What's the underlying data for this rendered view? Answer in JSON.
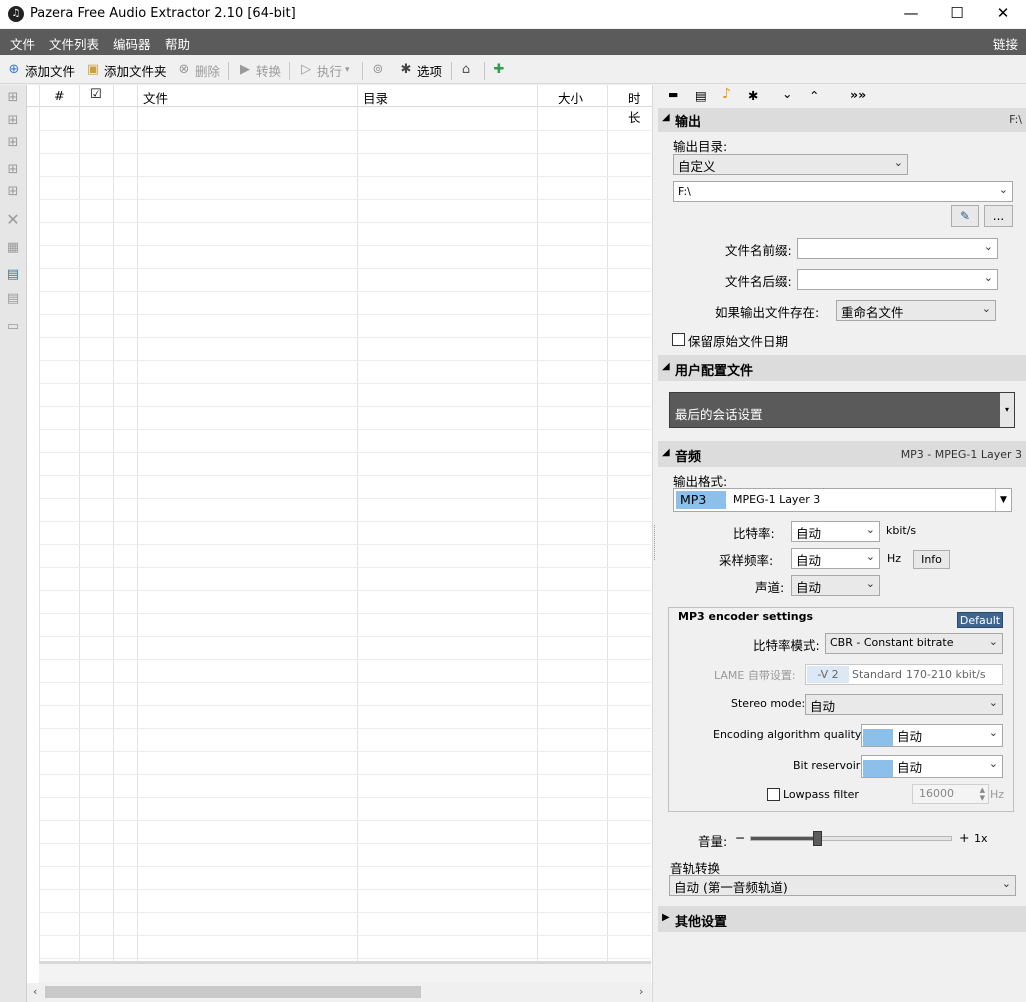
{
  "window": {
    "title": "Pazera Free Audio Extractor 2.10  [64-bit]",
    "app_icon": "♫",
    "minimize": "—",
    "maximize": "☐",
    "close": "✕"
  },
  "menu": {
    "file": "文件",
    "filelist": "文件列表",
    "codec": "编码器",
    "help": "帮助",
    "links": "链接"
  },
  "toolbar": {
    "add_files": "添加文件",
    "add_folder": "添加文件夹",
    "delete": "删除",
    "convert": "转换",
    "execute": "执行",
    "options": "选项"
  },
  "grid": {
    "columns": {
      "num": "#",
      "check": "☑",
      "file": "文件",
      "dir": "目录",
      "size": "大小",
      "duration": "时长"
    }
  },
  "panel_tabs": {
    "folder": "▬",
    "doc": "▤",
    "music": "♪",
    "gear": "✱",
    "down": "⌄",
    "up": "⌃",
    "more": "»»"
  },
  "output": {
    "header": "输出",
    "drive": "F:\\",
    "dir_label": "输出目录:",
    "dir_mode": "自定义",
    "dir_path": "F:\\",
    "browse": "...",
    "prefix_label": "文件名前缀:",
    "prefix_value": "",
    "suffix_label": "文件名后缀:",
    "suffix_value": "",
    "exists_label": "如果输出文件存在:",
    "exists_value": "重命名文件",
    "keep_date": "保留原始文件日期"
  },
  "profile": {
    "header": "用户配置文件",
    "value": "最后的会话设置"
  },
  "audio": {
    "header": "音频",
    "summary": "MP3 - MPEG-1 Layer 3",
    "format_label": "输出格式:",
    "format_code": "MP3",
    "format_name": "MPEG-1 Layer 3",
    "bitrate_label": "比特率:",
    "bitrate_value": "自动",
    "bitrate_unit": "kbit/s",
    "samplerate_label": "采样频率:",
    "samplerate_value": "自动",
    "samplerate_unit": "Hz",
    "info_button": "Info",
    "channels_label": "声道:",
    "channels_value": "自动"
  },
  "mp3": {
    "title": "MP3 encoder settings",
    "default_button": "Default",
    "mode_label": "比特率模式:",
    "mode_value": "CBR - Constant bitrate",
    "lame_label": "LAME 自带设置:",
    "lame_v": "-V 2",
    "lame_std": "Standard",
    "lame_range": "170-210 kbit/s",
    "stereo_label": "Stereo mode:",
    "stereo_value": "自动",
    "quality_label": "Encoding algorithm quality:",
    "quality_value": "自动",
    "reservoir_label": "Bit reservoir:",
    "reservoir_value": "自动",
    "lowpass_label": "Lowpass filter",
    "lowpass_value": "16000",
    "lowpass_unit": "Hz"
  },
  "volume": {
    "label": "音量:",
    "minus": "−",
    "plus": "+",
    "mult": "1x",
    "level": 0.33
  },
  "track": {
    "label": "音轨转换",
    "value": "自动 (第一音频轨道)"
  },
  "other": {
    "header": "其他设置"
  },
  "colors": {
    "menubar": "#5b5b5b",
    "profile_bg": "#5a5a5a",
    "default_btn": "#3e6690",
    "swatch": "#8cc0ea"
  }
}
